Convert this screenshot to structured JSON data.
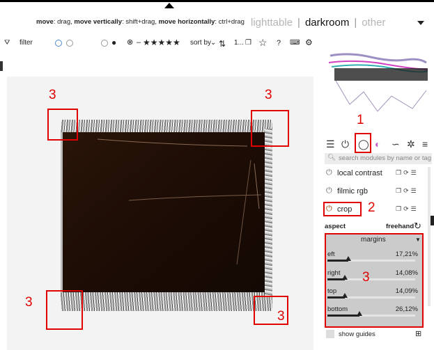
{
  "header": {
    "hint_parts": [
      {
        "b": "move",
        "t": ": drag, "
      },
      {
        "b": "move vertically",
        "t": ": shift+drag, "
      },
      {
        "b": "move horizontally",
        "t": ": ctrl+drag"
      }
    ],
    "views": [
      "lighttable",
      "darkroom",
      "other"
    ],
    "active_view": "darkroom"
  },
  "filterbar": {
    "filter_label": "filter",
    "sort_label": "sort by",
    "stars": "★★★★★",
    "count": "1...",
    "help": "?"
  },
  "annotations": {
    "labels": [
      "1",
      "2",
      "3",
      "3",
      "3",
      "3",
      "3"
    ]
  },
  "modules": {
    "search_placeholder": "search modules by name or tag",
    "items": [
      {
        "label": "local contrast"
      },
      {
        "label": "filmic rgb"
      },
      {
        "label": "crop"
      }
    ]
  },
  "crop": {
    "aspect_label": "aspect",
    "aspect_value": "freehand",
    "margins_header": "margins",
    "sliders": [
      {
        "name": "left",
        "display": "eft",
        "value": "17,21%",
        "fraction": 0.1721
      },
      {
        "name": "right",
        "display": "right",
        "value": "14,08%",
        "fraction": 0.1408
      },
      {
        "name": "top",
        "display": "top",
        "value": "14,09%",
        "fraction": 0.1409
      },
      {
        "name": "bottom",
        "display": "bottom",
        "value": "26,12%",
        "fraction": 0.2612
      }
    ],
    "show_guides_label": "show guides"
  },
  "colors": {
    "annotation_red": "#e00000",
    "panel_gray": "#cbcbcb"
  }
}
